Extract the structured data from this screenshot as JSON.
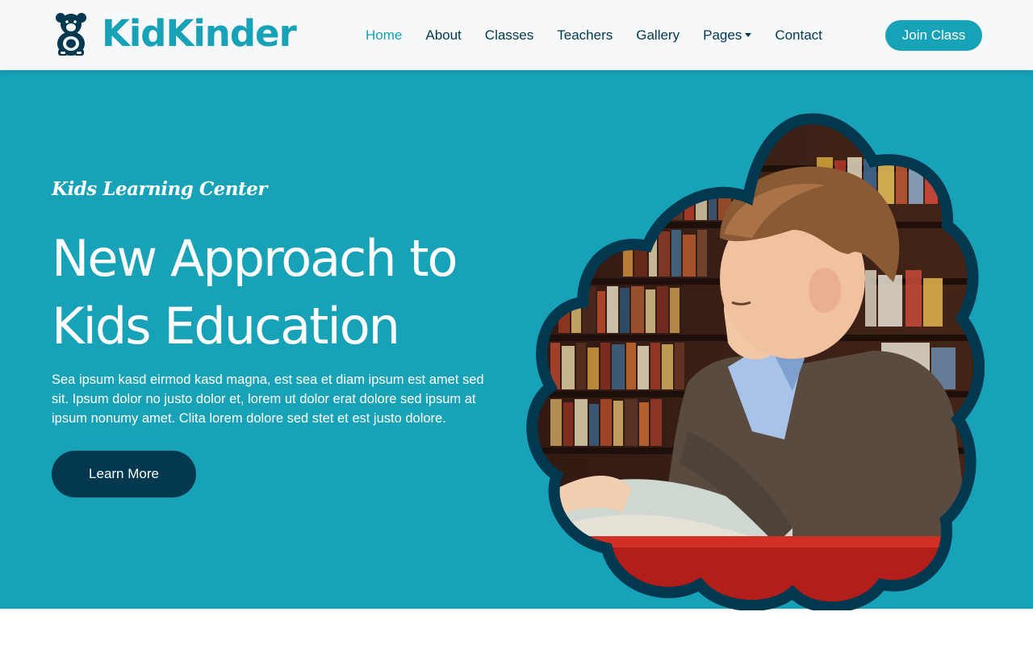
{
  "brand": {
    "name": "KidKinder",
    "icon": "teddy-bear-icon",
    "color": "#17a2b8"
  },
  "nav": {
    "items": [
      {
        "label": "Home",
        "active": true
      },
      {
        "label": "About",
        "active": false
      },
      {
        "label": "Classes",
        "active": false
      },
      {
        "label": "Teachers",
        "active": false
      },
      {
        "label": "Gallery",
        "active": false
      },
      {
        "label": "Pages",
        "active": false,
        "dropdown": true
      },
      {
        "label": "Contact",
        "active": false
      }
    ],
    "cta_label": "Join Class"
  },
  "hero": {
    "eyebrow": "Kids Learning Center",
    "title_line1": "New Approach to",
    "title_line2": "Kids Education",
    "description": "Sea ipsum kasd eirmod kasd magna, est sea et diam ipsum est amet sed sit. Ipsum dolor no justo dolor et, lorem ut dolor erat dolore sed ipsum at ipsum nonumy amet. Clita lorem dolore sed stet et est justo dolore.",
    "button_label": "Learn More",
    "image": "boy-reading-book-in-library-photo"
  },
  "colors": {
    "primary": "#17a2b8",
    "dark": "#00394f",
    "navbar_bg": "#f6f8fa",
    "white": "#ffffff"
  }
}
